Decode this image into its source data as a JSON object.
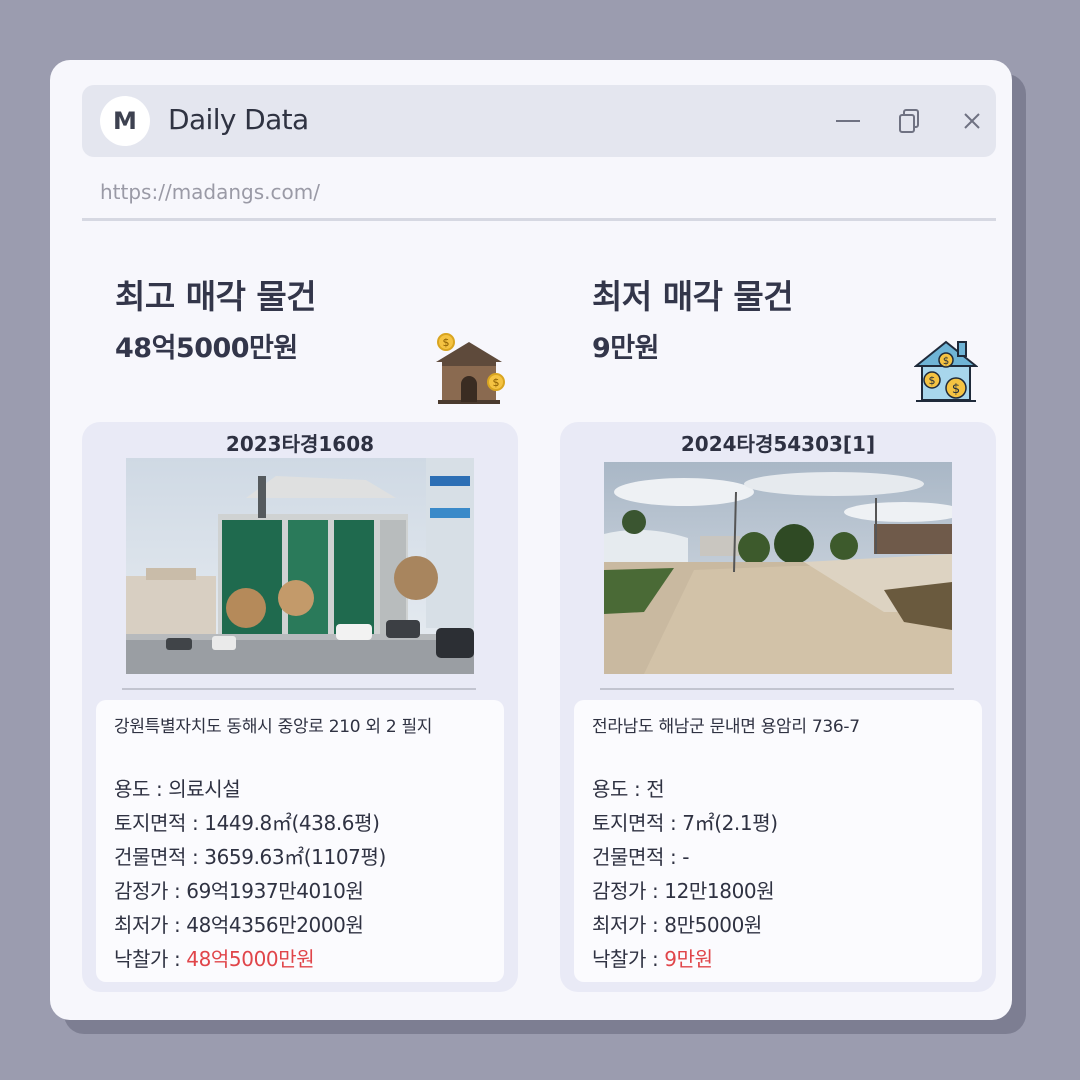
{
  "app": {
    "avatar_letter": "M",
    "title": "Daily Data",
    "url": "https://madangs.com/"
  },
  "colors": {
    "background": "#9b9caf",
    "window": "#f7f7fc",
    "card": "#e9eaf6",
    "highlight": "#e0454a"
  },
  "highest": {
    "heading": "최고 매각 물건",
    "price": "48억5000만원",
    "case_no": "2023타경1608",
    "address": "강원특별자치도 동해시 중앙로 210 외 2 필지",
    "usage_label": "용도 : ",
    "usage": "의료시설",
    "land_label": "토지면적 : ",
    "land": "1449.8㎡(438.6평)",
    "building_label": "건물면적 : ",
    "building": "3659.63㎡(1107평)",
    "appraisal_label": "감정가 : ",
    "appraisal": "69억1937만4010원",
    "minimum_label": "최저가 : ",
    "minimum": "48억4356만2000원",
    "winning_label": "낙찰가 : ",
    "winning": "48억5000만원",
    "icon": "house-coins-icon"
  },
  "lowest": {
    "heading": "최저 매각 물건",
    "price": "9만원",
    "case_no": "2024타경54303[1]",
    "address": "전라남도 해남군 문내면 용암리 736-7",
    "usage_label": "용도 : ",
    "usage": "전",
    "land_label": "토지면적 : ",
    "land": "7㎡(2.1평)",
    "building_label": "건물면적 : ",
    "building": "-",
    "appraisal_label": "감정가 : ",
    "appraisal": "12만1800원",
    "minimum_label": "최저가 : ",
    "minimum": "8만5000원",
    "winning_label": "낙찰가 : ",
    "winning": "9만원",
    "icon": "house-money-icon"
  }
}
